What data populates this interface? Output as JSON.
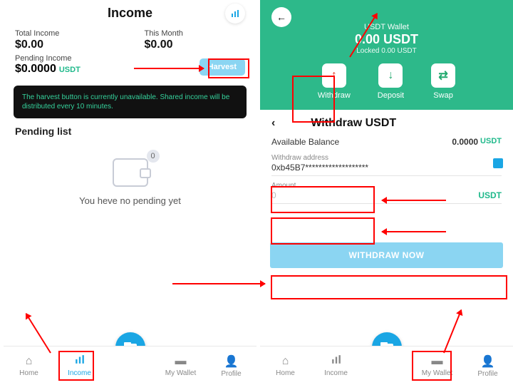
{
  "left": {
    "title": "Income",
    "total_label": "Total Income",
    "total_value": "$0.00",
    "month_label": "This Month",
    "month_value": "$0.00",
    "pending_label": "Pending Income",
    "pending_value": "$0.0000",
    "pending_unit": "USDT",
    "harvest": "Harvest",
    "banner": "The harvest button is currently unavailable. Shared income will be distributed every 10 minutes.",
    "pending_list": "Pending list",
    "empty_badge": "0",
    "empty_text": "You heve no pending yet"
  },
  "right": {
    "wallet_label": "USDT Wallet",
    "wallet_amount": "0.00 USDT",
    "wallet_locked": "Locked 0.00 USDT",
    "withdraw": "Withdraw",
    "deposit": "Deposit",
    "swap": "Swap",
    "withdraw_title": "Withdraw USDT",
    "balance_label": "Available Balance",
    "balance_value": "0.0000",
    "balance_unit": "USDT",
    "addr_label": "Withdraw address",
    "addr_value": "0xb45B7*******************",
    "amount_label": "Amount",
    "amount_ph": "0",
    "amount_unit": "USDT",
    "withdraw_now": "WITHDRAW NOW"
  },
  "nav": {
    "home": "Home",
    "income": "Income",
    "wallet": "My Wallet",
    "profile": "Profile"
  }
}
